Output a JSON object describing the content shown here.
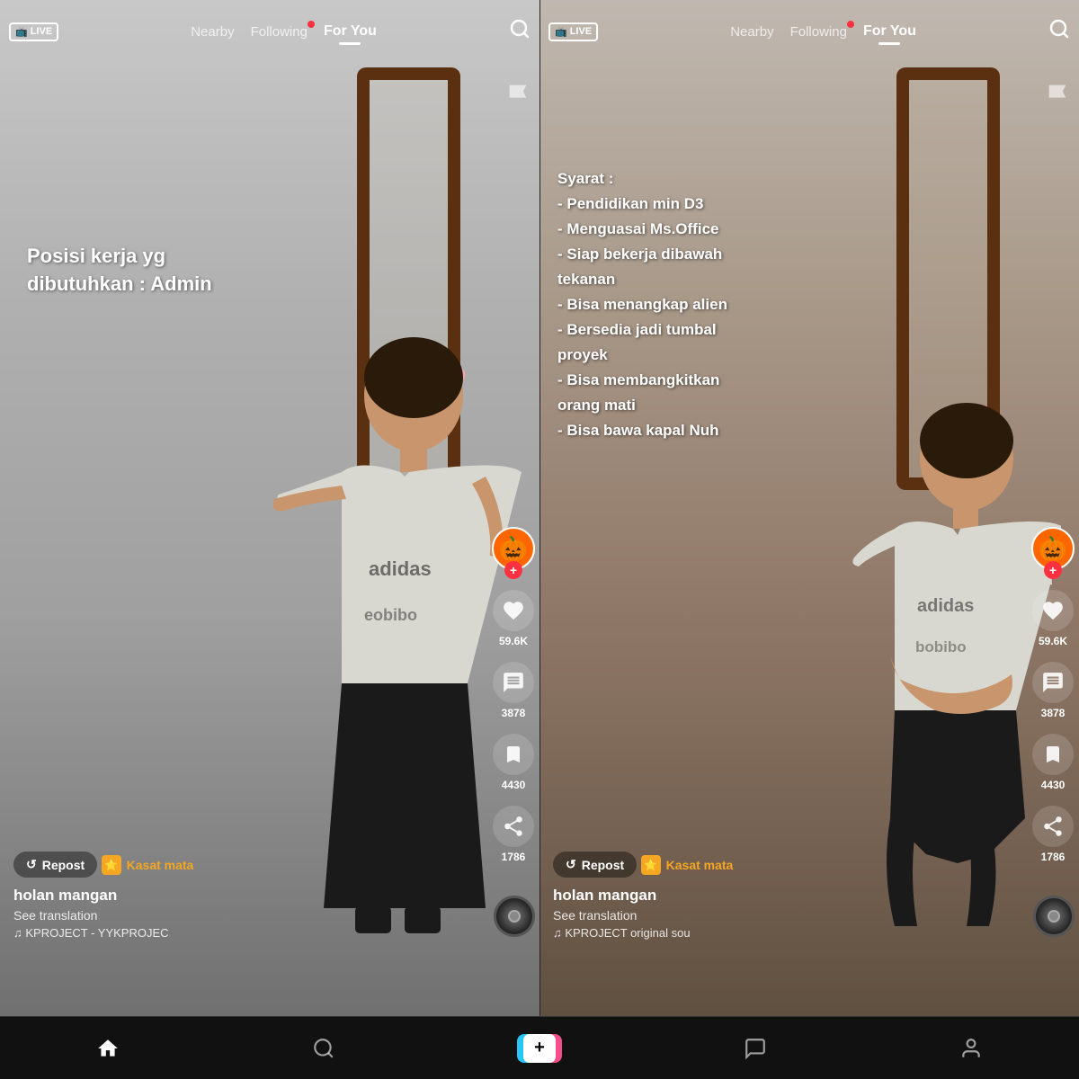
{
  "panels": [
    {
      "id": "left",
      "nav": {
        "live_label": "LIVE",
        "nearby": "Nearby",
        "following": "Following",
        "for_you": "For You",
        "following_has_dot": true
      },
      "content_text": "Posisi kerja yg\ndibutuhkan : Admin",
      "actions": {
        "likes": "59.6K",
        "comments": "3878",
        "bookmarks": "4430",
        "shares": "1786",
        "avatar_emoji": "🎃"
      },
      "bottom": {
        "repost_label": "Repost",
        "badge_label": "Kasat mata",
        "username": "holan mangan",
        "translation": "See translation",
        "music": "♫ KPROJECT - YYKPROJEC"
      },
      "flag_symbol": "⚑"
    },
    {
      "id": "right",
      "nav": {
        "live_label": "LIVE",
        "nearby": "Nearby",
        "following": "Following",
        "for_you": "For You",
        "following_has_dot": true
      },
      "content_text": "Syarat :\n- Pendidikan min D3\n- Menguasai Ms.Office\n- Siap bekerja dibawah\n  tekanan\n- Bisa menangkap alien\n- Bersedia jadi tumbal\n  proyek\n- Bisa membangkitkan\n  orang mati\n- Bisa bawa kapal Nuh",
      "actions": {
        "likes": "59.6K",
        "comments": "3878",
        "bookmarks": "4430",
        "shares": "1786",
        "avatar_emoji": "🎃"
      },
      "bottom": {
        "repost_label": "Repost",
        "badge_label": "Kasat mata",
        "username": "holan mangan",
        "translation": "See translation",
        "music": "♫ KPROJECT    original sou"
      },
      "flag_symbol": "⚑"
    }
  ],
  "bottom_nav": {
    "items": [
      {
        "icon": "⌂",
        "label": "Home"
      },
      {
        "icon": "🔍",
        "label": "Discover"
      },
      {
        "icon": "+",
        "label": ""
      },
      {
        "icon": "💬",
        "label": "Inbox"
      },
      {
        "icon": "👤",
        "label": "Profile"
      }
    ]
  }
}
